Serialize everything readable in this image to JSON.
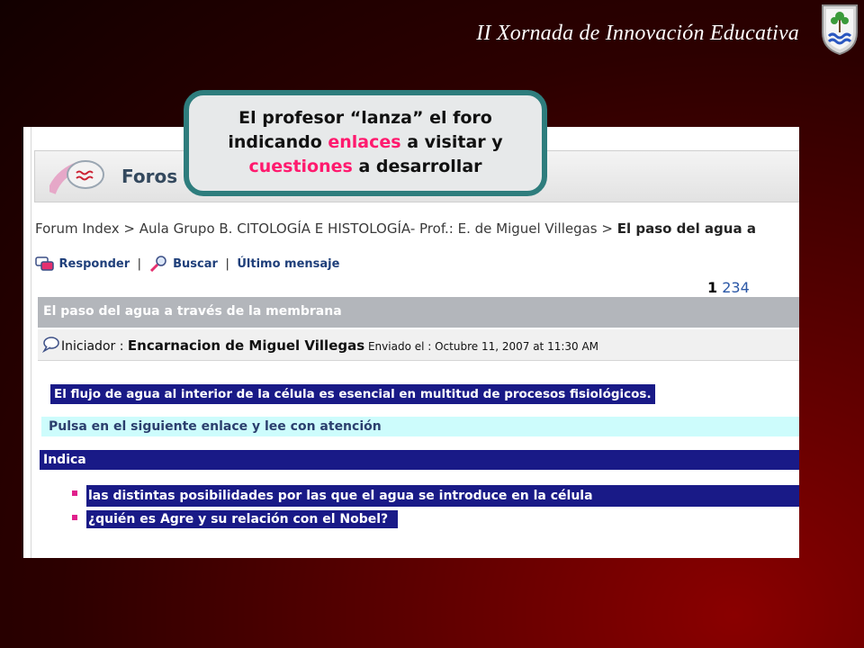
{
  "slide": {
    "title": "II Xornada de Innovación Educativa"
  },
  "callout": {
    "line1": "El profesor “lanza” el foro",
    "line2_pre": "indicando ",
    "line2_hi": "enlaces",
    "line2_post": " a visitar y",
    "line3_hi": "cuestiones",
    "line3_post": " a desarrollar",
    "highlight_color": "#ff1a6e",
    "border_color": "#2e7d7d"
  },
  "forum": {
    "section_label": "Foros",
    "breadcrumb": {
      "home": "Forum Index",
      "sep": " > ",
      "course": "Aula Grupo B. CITOLOGÍA E HISTOLOGÍA- Prof.: E. de Miguel Villegas",
      "current": "El paso del agua a"
    },
    "actions": {
      "reply": "Responder",
      "sep": "|",
      "search": "Buscar",
      "last": "Último mensaje"
    },
    "pagination": {
      "current": "1",
      "pages": [
        "2",
        "3",
        "4"
      ]
    },
    "thread": {
      "title": "El paso del agua a través de la membrana",
      "starter_label": "Iniciador : ",
      "starter_name": "Encarnacion de Miguel Villegas",
      "sent": " Enviado el : Octubre 11, 2007 at 11:30 AM"
    },
    "post": {
      "intro": "El flujo de agua al interior de la célula es esencial en multitud de procesos fisiológicos.",
      "link_prompt": "Pulsa en el siguiente enlace y lee con atención",
      "indica": "Indica",
      "questions": [
        "las distintas posibilidades por las que el agua se introduce en la célula",
        "¿quién es Agre y su relación con el Nobel?"
      ]
    }
  },
  "colors": {
    "navy_highlight": "#191a87",
    "cyan_bar": "#cdfcfc",
    "thread_bar": "#b3b6bb",
    "bullet": "#e0208c"
  }
}
